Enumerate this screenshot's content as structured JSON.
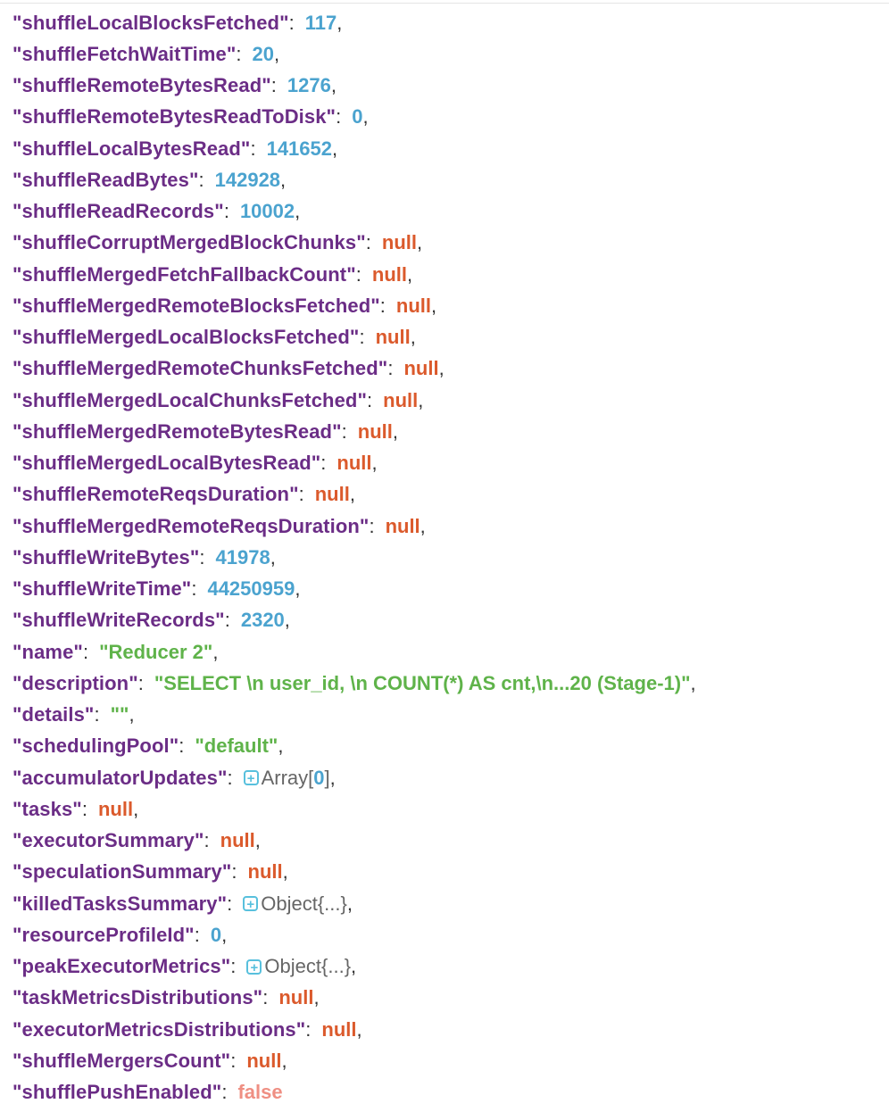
{
  "rows": [
    {
      "key": "\"shuffleLocalBlocksFetched\"",
      "type": "number",
      "value": "117",
      "comma": ","
    },
    {
      "key": "\"shuffleFetchWaitTime\"",
      "type": "number",
      "value": "20",
      "comma": ","
    },
    {
      "key": "\"shuffleRemoteBytesRead\"",
      "type": "number",
      "value": "1276",
      "comma": ","
    },
    {
      "key": "\"shuffleRemoteBytesReadToDisk\"",
      "type": "number",
      "value": "0",
      "comma": ","
    },
    {
      "key": "\"shuffleLocalBytesRead\"",
      "type": "number",
      "value": "141652",
      "comma": ","
    },
    {
      "key": "\"shuffleReadBytes\"",
      "type": "number",
      "value": "142928",
      "comma": ","
    },
    {
      "key": "\"shuffleReadRecords\"",
      "type": "number",
      "value": "10002",
      "comma": ","
    },
    {
      "key": "\"shuffleCorruptMergedBlockChunks\"",
      "type": "null",
      "value": "null",
      "comma": ","
    },
    {
      "key": "\"shuffleMergedFetchFallbackCount\"",
      "type": "null",
      "value": "null",
      "comma": ","
    },
    {
      "key": "\"shuffleMergedRemoteBlocksFetched\"",
      "type": "null",
      "value": "null",
      "comma": ","
    },
    {
      "key": "\"shuffleMergedLocalBlocksFetched\"",
      "type": "null",
      "value": "null",
      "comma": ","
    },
    {
      "key": "\"shuffleMergedRemoteChunksFetched\"",
      "type": "null",
      "value": "null",
      "comma": ","
    },
    {
      "key": "\"shuffleMergedLocalChunksFetched\"",
      "type": "null",
      "value": "null",
      "comma": ","
    },
    {
      "key": "\"shuffleMergedRemoteBytesRead\"",
      "type": "null",
      "value": "null",
      "comma": ","
    },
    {
      "key": "\"shuffleMergedLocalBytesRead\"",
      "type": "null",
      "value": "null",
      "comma": ","
    },
    {
      "key": "\"shuffleRemoteReqsDuration\"",
      "type": "null",
      "value": "null",
      "comma": ","
    },
    {
      "key": "\"shuffleMergedRemoteReqsDuration\"",
      "type": "null",
      "value": "null",
      "comma": ","
    },
    {
      "key": "\"shuffleWriteBytes\"",
      "type": "number",
      "value": "41978",
      "comma": ","
    },
    {
      "key": "\"shuffleWriteTime\"",
      "type": "number",
      "value": "44250959",
      "comma": ","
    },
    {
      "key": "\"shuffleWriteRecords\"",
      "type": "number",
      "value": "2320",
      "comma": ","
    },
    {
      "key": "\"name\"",
      "type": "string",
      "value": "\"Reducer 2\"",
      "comma": ","
    },
    {
      "key": "\"description\"",
      "type": "string",
      "value": "\"SELECT \\n  user_id, \\n  COUNT(*) AS cnt,\\n...20 (Stage-1)\"",
      "comma": ","
    },
    {
      "key": "\"details\"",
      "type": "string",
      "value": "\"\"",
      "comma": ","
    },
    {
      "key": "\"schedulingPool\"",
      "type": "string",
      "value": "\"default\"",
      "comma": ","
    },
    {
      "key": "\"accumulatorUpdates\"",
      "type": "array",
      "value": "Array[",
      "index": "0",
      "suffix": "]",
      "comma": ","
    },
    {
      "key": "\"tasks\"",
      "type": "null",
      "value": "null",
      "comma": ","
    },
    {
      "key": "\"executorSummary\"",
      "type": "null",
      "value": "null",
      "comma": ","
    },
    {
      "key": "\"speculationSummary\"",
      "type": "null",
      "value": "null",
      "comma": ","
    },
    {
      "key": "\"killedTasksSummary\"",
      "type": "object",
      "value": "Object{...}",
      "comma": ","
    },
    {
      "key": "\"resourceProfileId\"",
      "type": "number",
      "value": "0",
      "comma": ","
    },
    {
      "key": "\"peakExecutorMetrics\"",
      "type": "object",
      "value": "Object{...}",
      "comma": ","
    },
    {
      "key": "\"taskMetricsDistributions\"",
      "type": "null",
      "value": "null",
      "comma": ","
    },
    {
      "key": "\"executorMetricsDistributions\"",
      "type": "null",
      "value": "null",
      "comma": ","
    },
    {
      "key": "\"shuffleMergersCount\"",
      "type": "null",
      "value": "null",
      "comma": ","
    },
    {
      "key": "\"shufflePushEnabled\"",
      "type": "bool",
      "value": "false",
      "comma": ""
    }
  ],
  "colon": ":",
  "expand_icon": "plus-square-icon",
  "colors": {
    "key": "#6b2d86",
    "number": "#4ba3cf",
    "null": "#db5a2c",
    "string": "#5fb34a",
    "bool": "#ef8f83",
    "expand": "#58c0dd"
  }
}
